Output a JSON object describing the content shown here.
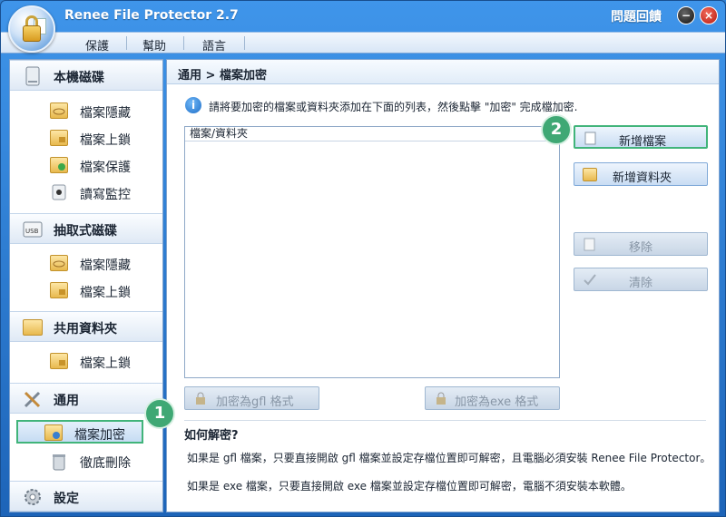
{
  "app": {
    "title": "Renee File Protector 2.7",
    "feedback_label": "問題回饋",
    "minimize_symbol": "−",
    "close_symbol": "×",
    "logo_icon": "file-lock-logo-icon"
  },
  "menu": {
    "items": [
      {
        "label": "保護"
      },
      {
        "label": "幫助"
      },
      {
        "label": "語言"
      }
    ]
  },
  "sidebar": {
    "sections": [
      {
        "label": "本機磁碟",
        "icon": "hard-disk-icon",
        "items": [
          {
            "label": "檔案隱藏",
            "icon": "folder-hide-icon"
          },
          {
            "label": "檔案上鎖",
            "icon": "folder-lock-icon"
          },
          {
            "label": "檔案保護",
            "icon": "folder-protect-icon"
          },
          {
            "label": "讀寫監控",
            "icon": "disk-monitor-icon"
          }
        ]
      },
      {
        "label": "抽取式磁碟",
        "icon": "usb-drive-icon",
        "usb_text": "USB",
        "items": [
          {
            "label": "檔案隱藏",
            "icon": "folder-hide-icon"
          },
          {
            "label": "檔案上鎖",
            "icon": "folder-lock-icon"
          }
        ]
      },
      {
        "label": "共用資料夾",
        "icon": "shared-folder-icon",
        "items": [
          {
            "label": "檔案上鎖",
            "icon": "folder-lock-icon"
          }
        ]
      },
      {
        "label": "通用",
        "icon": "tools-icon",
        "items": [
          {
            "label": "檔案加密",
            "icon": "folder-encrypt-icon",
            "active": true
          },
          {
            "label": "徹底刪除",
            "icon": "trash-icon"
          }
        ]
      },
      {
        "label": "設定",
        "icon": "gear-icon",
        "items": []
      }
    ]
  },
  "content": {
    "breadcrumb": "通用 > 檔案加密",
    "info_text": "請將要加密的檔案或資料夾添加在下面的列表，然後點擊 \"加密\" 完成檔加密.",
    "list_header": "檔案/資料夾",
    "buttons": {
      "add_file": "新增檔案",
      "add_folder": "新增資料夾",
      "remove": "移除",
      "clear": "清除",
      "encrypt_gfl": "加密為gfl 格式",
      "encrypt_exe": "加密為exe 格式"
    },
    "how_to_decrypt": {
      "title": "如何解密?",
      "line1": "如果是 gfl 檔案，只要直接開啟 gfl 檔案並設定存檔位置即可解密，且電腦必須安裝 Renee File Protector。",
      "line2": "如果是 exe 檔案，只要直接開啟 exe 檔案並設定存檔位置即可解密，電腦不須安裝本軟體。"
    }
  },
  "badges": {
    "step1": "1",
    "step2": "2"
  },
  "colors": {
    "title_bar": "#2f7fd1",
    "highlight": "#41b47a",
    "badge": "#3fa874"
  }
}
